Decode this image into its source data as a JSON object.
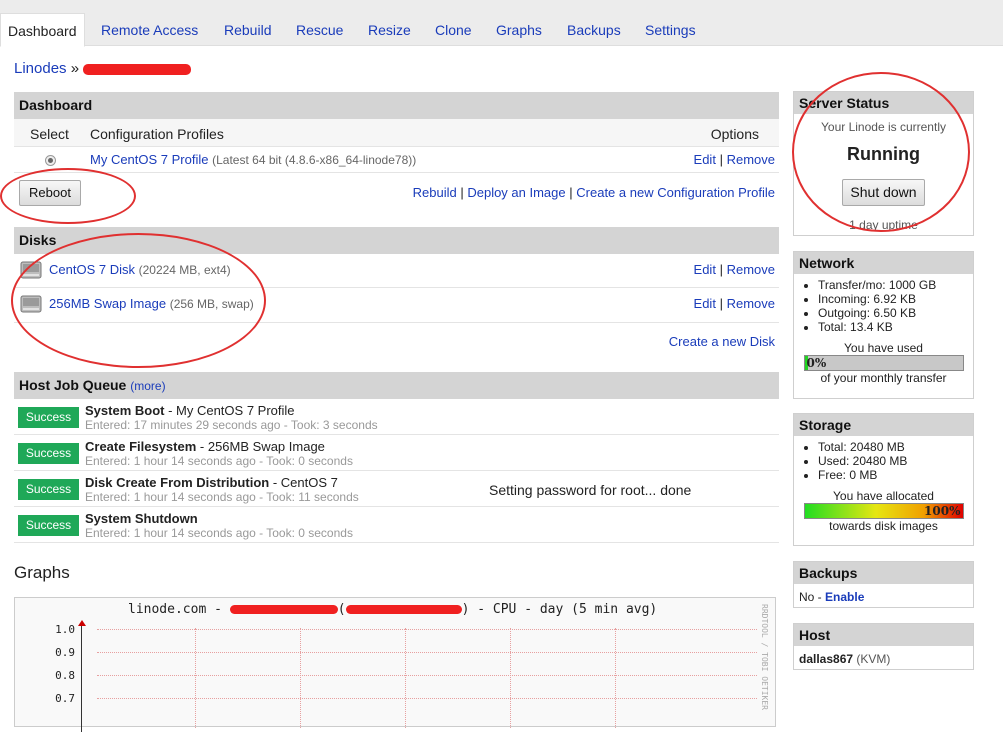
{
  "tabs": [
    {
      "label": "Dashboard"
    },
    {
      "label": "Remote Access"
    },
    {
      "label": "Rebuild"
    },
    {
      "label": "Rescue"
    },
    {
      "label": "Resize"
    },
    {
      "label": "Clone"
    },
    {
      "label": "Graphs"
    },
    {
      "label": "Backups"
    },
    {
      "label": "Settings"
    }
  ],
  "breadcrumb": {
    "root": "Linodes",
    "sep": "»"
  },
  "dashboard": {
    "title": "Dashboard",
    "col_select": "Select",
    "col_profiles": "Configuration Profiles",
    "col_options": "Options",
    "profile_name": "My CentOS 7 Profile",
    "profile_detail": "(Latest 64 bit (4.8.6-x86_64-linode78))",
    "edit": "Edit",
    "sep": "|",
    "remove": "Remove",
    "reboot": "Reboot",
    "rebuild": "Rebuild",
    "deploy": "Deploy an Image",
    "create_config": "Create a new Configuration Profile"
  },
  "disks": {
    "title": "Disks",
    "items": [
      {
        "name": "CentOS 7 Disk",
        "detail": "(20224 MB, ext4)"
      },
      {
        "name": "256MB Swap Image",
        "detail": "(256 MB, swap)"
      }
    ],
    "edit": "Edit",
    "remove": "Remove",
    "sep": "|",
    "create": "Create a new Disk"
  },
  "jobs": {
    "title": "Host Job Queue",
    "more": "(more)",
    "items": [
      {
        "status": "Success",
        "name": "System Boot",
        "target": " - My CentOS 7 Profile",
        "meta": "Entered: 17 minutes 29 seconds ago - Took: 3 seconds",
        "message": ""
      },
      {
        "status": "Success",
        "name": "Create Filesystem",
        "target": " - 256MB Swap Image",
        "meta": "Entered: 1 hour 14 seconds ago - Took: 0 seconds",
        "message": ""
      },
      {
        "status": "Success",
        "name": "Disk Create From Distribution",
        "target": " - CentOS 7",
        "meta": "Entered: 1 hour 14 seconds ago - Took: 11 seconds",
        "message": "Setting password for root... done"
      },
      {
        "status": "Success",
        "name": "System Shutdown",
        "target": "",
        "meta": "Entered: 1 hour 14 seconds ago - Took: 0 seconds",
        "message": ""
      }
    ]
  },
  "graphs": {
    "title": "Graphs",
    "chart_title_prefix": "linode.com - ",
    "chart_title_suffix": " - CPU - day (5 min avg)",
    "paren_open": "(",
    "paren_close": ")",
    "side_label": "RRDTOOL / TOBI OETIKER",
    "yticks": [
      "1.0",
      "0.9",
      "0.8",
      "0.7"
    ]
  },
  "status": {
    "title": "Server Status",
    "line1": "Your Linode is currently",
    "state": "Running",
    "button": "Shut down",
    "uptime": "1 day uptime"
  },
  "network": {
    "title": "Network",
    "items": [
      "Transfer/mo: 1000 GB",
      "Incoming: 6.92 KB",
      "Outgoing: 6.50 KB",
      "Total: 13.4 KB"
    ],
    "used_label": "You have used",
    "percent_text": "0%",
    "percent_value": 0,
    "footer": "of your monthly transfer"
  },
  "storage": {
    "title": "Storage",
    "items": [
      "Total: 20480 MB",
      "Used: 20480 MB",
      "Free: 0 MB"
    ],
    "alloc_label": "You have allocated",
    "percent_text": "100%",
    "percent_value": 100,
    "footer": "towards disk images"
  },
  "backups": {
    "title": "Backups",
    "text": "No - ",
    "enable": "Enable"
  },
  "host": {
    "title": "Host",
    "name": "dallas867",
    "type": "(KVM)"
  },
  "colors": {
    "success": "#1fa858",
    "annotation": "#e03030",
    "link": "#1a3cba",
    "header": "#d4d4d4"
  }
}
